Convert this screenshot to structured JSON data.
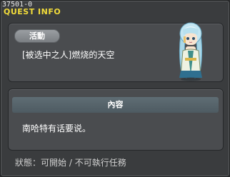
{
  "window": {
    "quest_id": "37501-0",
    "title": "QUEST INFO"
  },
  "activity": {
    "badge_label": "活動",
    "quest_name": "[被选中之人]燃烧的天空",
    "npc_icon": "npc-portrait-icon"
  },
  "content": {
    "header": "內容",
    "text": "南哈特有话要说。"
  },
  "status": {
    "label": "狀態：",
    "value": "可開始 / 不可執行任務"
  },
  "colors": {
    "title": "#f2dc3a",
    "panel": "#4a4c4f",
    "header_bar": "#56646b",
    "background": "#3a3c3e"
  }
}
